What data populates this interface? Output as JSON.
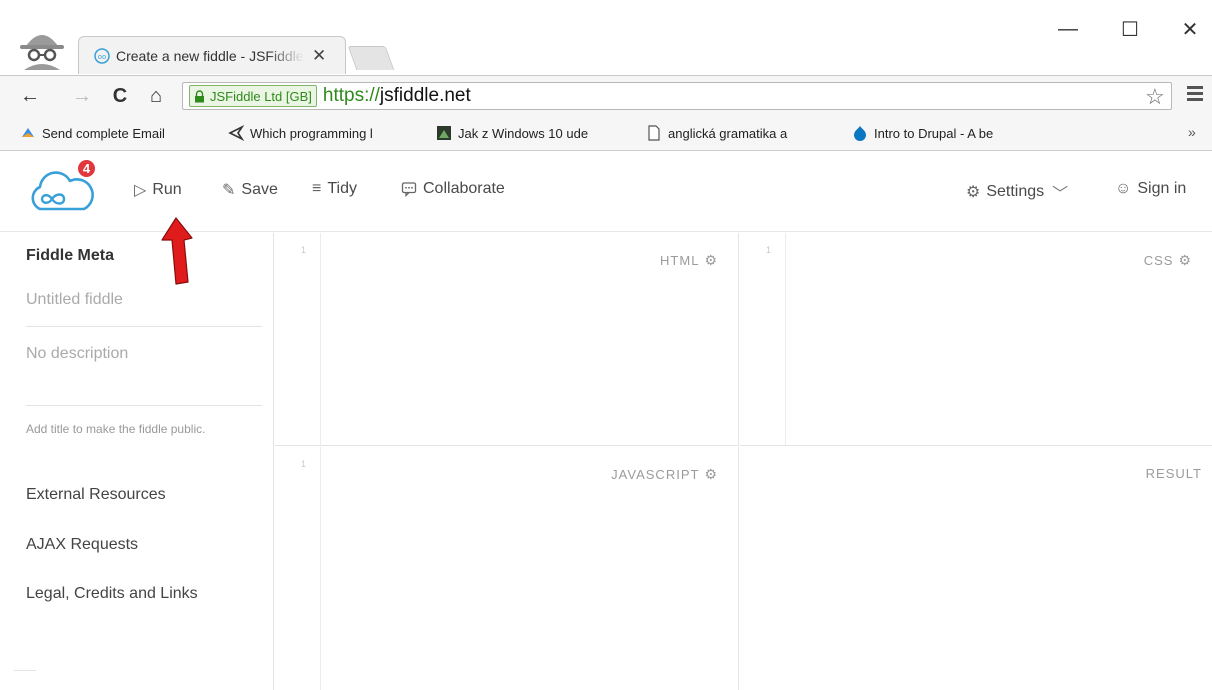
{
  "browser": {
    "tab_title": "Create a new fiddle - JSFiddle",
    "tab_close": "✕",
    "window_buttons": {
      "minimize": "—",
      "maximize": "☐",
      "close": "✕"
    },
    "ev_cert": "JSFiddle Ltd [GB]",
    "url_scheme": "https://",
    "url_host": "jsfiddle.net",
    "bookmarks": [
      {
        "label": "Send complete Email",
        "icon": "email-bookmark-icon"
      },
      {
        "label": "Which programming l",
        "icon": "code-bookmark-icon"
      },
      {
        "label": "Jak z Windows 10 ude",
        "icon": "image-bookmark-icon"
      },
      {
        "label": "anglická gramatika a",
        "icon": "page-bookmark-icon"
      },
      {
        "label": "Intro to Drupal - A be",
        "icon": "drupal-bookmark-icon"
      }
    ],
    "bookmarks_more": "»"
  },
  "header": {
    "notification_count": "4",
    "run": "Run",
    "save": "Save",
    "tidy": "Tidy",
    "collaborate": "Collaborate",
    "settings": "Settings",
    "sign_in": "Sign in"
  },
  "sidebar": {
    "meta_title": "Fiddle Meta",
    "name_placeholder": "Untitled fiddle",
    "desc_placeholder": "No description",
    "hint": "Add title to make the fiddle public.",
    "links": [
      "External Resources",
      "AJAX Requests",
      "Legal, Credits and Links"
    ]
  },
  "panes": {
    "html": "HTML",
    "css": "CSS",
    "javascript": "JAVASCRIPT",
    "result": "RESULT",
    "line_number": "1"
  },
  "colors": {
    "accent_blue": "#38a0d8",
    "badge_red": "#e0383e",
    "arrow_red": "#e01b1b",
    "ev_green": "#2f8a1c"
  }
}
